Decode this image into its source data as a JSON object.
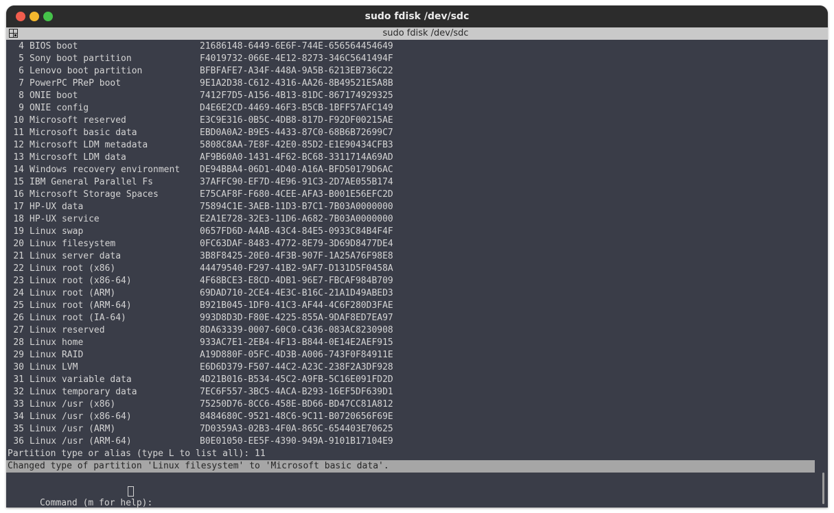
{
  "window": {
    "title": "sudo fdisk /dev/sdc",
    "tab_title": "sudo fdisk /dev/sdc"
  },
  "icons": {
    "window_close": "close-dot",
    "window_minimize": "minimize-dot",
    "window_maximize": "maximize-dot",
    "tab": "terminal-tab-icon"
  },
  "colors": {
    "terminal_bg": "#3a3d48",
    "terminal_fg": "#d4d4d4",
    "highlight_bg": "#a6a6a6",
    "titlebar_bg": "#2c2c2c"
  },
  "partition_types": [
    {
      "num": "4",
      "name": "BIOS boot",
      "guid": "21686148-6449-6E6F-744E-656564454649"
    },
    {
      "num": "5",
      "name": "Sony boot partition",
      "guid": "F4019732-066E-4E12-8273-346C5641494F"
    },
    {
      "num": "6",
      "name": "Lenovo boot partition",
      "guid": "BFBFAFE7-A34F-448A-9A5B-6213EB736C22"
    },
    {
      "num": "7",
      "name": "PowerPC PReP boot",
      "guid": "9E1A2D38-C612-4316-AA26-8B49521E5A8B"
    },
    {
      "num": "8",
      "name": "ONIE boot",
      "guid": "7412F7D5-A156-4B13-81DC-867174929325"
    },
    {
      "num": "9",
      "name": "ONIE config",
      "guid": "D4E6E2CD-4469-46F3-B5CB-1BFF57AFC149"
    },
    {
      "num": "10",
      "name": "Microsoft reserved",
      "guid": "E3C9E316-0B5C-4DB8-817D-F92DF00215AE"
    },
    {
      "num": "11",
      "name": "Microsoft basic data",
      "guid": "EBD0A0A2-B9E5-4433-87C0-68B6B72699C7"
    },
    {
      "num": "12",
      "name": "Microsoft LDM metadata",
      "guid": "5808C8AA-7E8F-42E0-85D2-E1E90434CFB3"
    },
    {
      "num": "13",
      "name": "Microsoft LDM data",
      "guid": "AF9B60A0-1431-4F62-BC68-3311714A69AD"
    },
    {
      "num": "14",
      "name": "Windows recovery environment",
      "guid": "DE94BBA4-06D1-4D40-A16A-BFD50179D6AC"
    },
    {
      "num": "15",
      "name": "IBM General Parallel Fs",
      "guid": "37AFFC90-EF7D-4E96-91C3-2D7AE055B174"
    },
    {
      "num": "16",
      "name": "Microsoft Storage Spaces",
      "guid": "E75CAF8F-F680-4CEE-AFA3-B001E56EFC2D"
    },
    {
      "num": "17",
      "name": "HP-UX data",
      "guid": "75894C1E-3AEB-11D3-B7C1-7B03A0000000"
    },
    {
      "num": "18",
      "name": "HP-UX service",
      "guid": "E2A1E728-32E3-11D6-A682-7B03A0000000"
    },
    {
      "num": "19",
      "name": "Linux swap",
      "guid": "0657FD6D-A4AB-43C4-84E5-0933C84B4F4F"
    },
    {
      "num": "20",
      "name": "Linux filesystem",
      "guid": "0FC63DAF-8483-4772-8E79-3D69D8477DE4"
    },
    {
      "num": "21",
      "name": "Linux server data",
      "guid": "3B8F8425-20E0-4F3B-907F-1A25A76F98E8"
    },
    {
      "num": "22",
      "name": "Linux root (x86)",
      "guid": "44479540-F297-41B2-9AF7-D131D5F0458A"
    },
    {
      "num": "23",
      "name": "Linux root (x86-64)",
      "guid": "4F68BCE3-E8CD-4DB1-96E7-FBCAF984B709"
    },
    {
      "num": "24",
      "name": "Linux root (ARM)",
      "guid": "69DAD710-2CE4-4E3C-B16C-21A1D49ABED3"
    },
    {
      "num": "25",
      "name": "Linux root (ARM-64)",
      "guid": "B921B045-1DF0-41C3-AF44-4C6F280D3FAE"
    },
    {
      "num": "26",
      "name": "Linux root (IA-64)",
      "guid": "993D8D3D-F80E-4225-855A-9DAF8ED7EA97"
    },
    {
      "num": "27",
      "name": "Linux reserved",
      "guid": "8DA63339-0007-60C0-C436-083AC8230908"
    },
    {
      "num": "28",
      "name": "Linux home",
      "guid": "933AC7E1-2EB4-4F13-B844-0E14E2AEF915"
    },
    {
      "num": "29",
      "name": "Linux RAID",
      "guid": "A19D880F-05FC-4D3B-A006-743F0F84911E"
    },
    {
      "num": "30",
      "name": "Linux LVM",
      "guid": "E6D6D379-F507-44C2-A23C-238F2A3DF928"
    },
    {
      "num": "31",
      "name": "Linux variable data",
      "guid": "4D21B016-B534-45C2-A9FB-5C16E091FD2D"
    },
    {
      "num": "32",
      "name": "Linux temporary data",
      "guid": "7EC6F557-3BC5-4ACA-B293-16EF5DF639D1"
    },
    {
      "num": "33",
      "name": "Linux /usr (x86)",
      "guid": "75250D76-8CC6-458E-BD66-BD47CC81A812"
    },
    {
      "num": "34",
      "name": "Linux /usr (x86-64)",
      "guid": "8484680C-9521-48C6-9C11-B0720656F69E"
    },
    {
      "num": "35",
      "name": "Linux /usr (ARM)",
      "guid": "7D0359A3-02B3-4F0A-865C-654403E70625"
    },
    {
      "num": "36",
      "name": "Linux /usr (ARM-64)",
      "guid": "B0E01050-EE5F-4390-949A-9101B17104E9"
    }
  ],
  "prompt_line": "Partition type or alias (type L to list all): 11",
  "status_line": "Changed type of partition 'Linux filesystem' to 'Microsoft basic data'.",
  "command_prompt": "Command (m for help): "
}
